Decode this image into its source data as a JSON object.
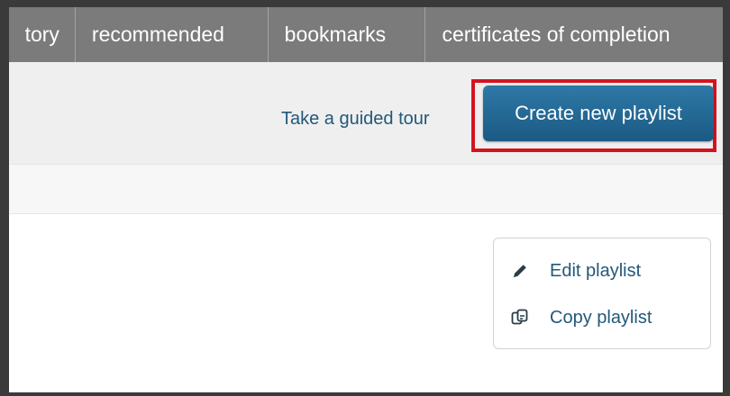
{
  "nav": {
    "tabs": [
      {
        "label": "tory"
      },
      {
        "label": "recommended"
      },
      {
        "label": "bookmarks"
      },
      {
        "label": "certificates of completion"
      }
    ]
  },
  "toolbar": {
    "tour_link": "Take a guided tour",
    "create_button": "Create new playlist"
  },
  "actions": {
    "edit": {
      "label": "Edit playlist",
      "icon": "pencil-icon"
    },
    "copy": {
      "label": "Copy playlist",
      "icon": "copy-icon"
    }
  },
  "colors": {
    "tab_bar": "#7b7b7b",
    "primary_button": "#1f6591",
    "link": "#23587a",
    "highlight": "#d3141f"
  }
}
